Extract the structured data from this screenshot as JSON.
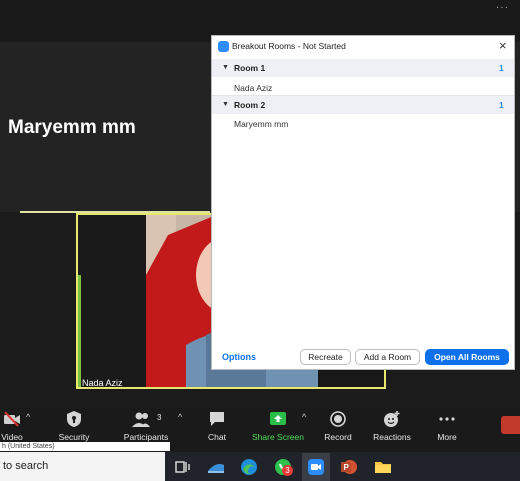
{
  "meeting": {
    "speaker_name": "Maryemm mm",
    "video_participant_name": "Nada Aziz",
    "top_more": "···"
  },
  "breakout": {
    "title": "Breakout Rooms - Not Started",
    "close_glyph": "×",
    "rooms": [
      {
        "label": "Room 1",
        "count": "1",
        "members": [
          "Nada Aziz"
        ]
      },
      {
        "label": "Room 2",
        "count": "1",
        "members": [
          "Maryemm mm"
        ]
      }
    ],
    "options_label": "Options",
    "recreate_label": "Recreate",
    "add_room_label": "Add a Room",
    "open_all_label": "Open All Rooms"
  },
  "toolbar": {
    "video_label": "Video",
    "security_label": "Security",
    "participants_label": "Participants",
    "participants_count": "3",
    "chat_label": "Chat",
    "share_label": "Share Screen",
    "record_label": "Record",
    "reactions_label": "Reactions",
    "more_label": "More",
    "caret": "^"
  },
  "taskbar": {
    "language_text": "h (United States)",
    "search_text": "to search",
    "whatsapp_badge": "3"
  },
  "colors": {
    "accent_blue": "#0e71eb",
    "share_green": "#4fdc5c",
    "active_speaker_border": "#e7e76f",
    "leave_red": "#c0392b"
  }
}
